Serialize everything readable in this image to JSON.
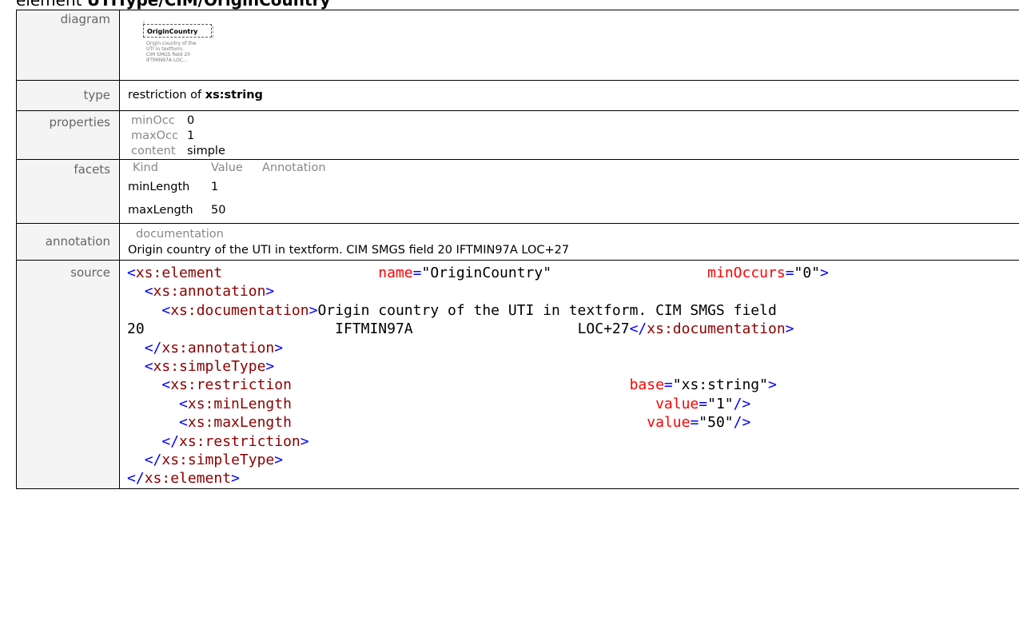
{
  "heading": {
    "kind": "element",
    "name": "UTIType/CIM/OriginCountry"
  },
  "labels": {
    "diagram": "diagram",
    "type": "type",
    "properties": "properties",
    "facets": "facets",
    "annotation": "annotation",
    "source": "source"
  },
  "diagram": {
    "element_name": "OriginCountry",
    "note_lines": [
      "Origin country of the",
      "UTI in textform.",
      "CIM SMGS field 20",
      "IFTMIN97A LOC..."
    ]
  },
  "type": {
    "prefix": "restriction of",
    "base": "xs:string"
  },
  "properties": [
    {
      "key": "minOcc",
      "value": "0"
    },
    {
      "key": "maxOcc",
      "value": "1"
    },
    {
      "key": "content",
      "value": "simple"
    }
  ],
  "facets": {
    "headers": [
      "Kind",
      "Value",
      "Annotation"
    ],
    "rows": [
      {
        "kind": "minLength",
        "value": "1",
        "annotation": ""
      },
      {
        "kind": "maxLength",
        "value": "50",
        "annotation": ""
      }
    ]
  },
  "annotation": {
    "header": "documentation",
    "text": "Origin country of the UTI in textform. CIM SMGS field 20 IFTMIN97A LOC+27"
  },
  "source": {
    "element_tag": "xs:element",
    "name_attr": "name",
    "name_val": "\"OriginCountry\"",
    "minocc_attr": "minOccurs",
    "minocc_val": "\"0\"",
    "annotation_tag": "xs:annotation",
    "documentation_tag": "xs:documentation",
    "doc_text_1": "Origin country of the UTI in textform. CIM SMGS field",
    "doc_text_2a": "20",
    "doc_text_2b": "IFTMIN97A",
    "doc_text_2c": "LOC+27",
    "simpletype_tag": "xs:simpleType",
    "restriction_tag": "xs:restriction",
    "base_attr": "base",
    "base_val": "\"xs:string\"",
    "minlength_tag": "xs:minLength",
    "maxlength_tag": "xs:maxLength",
    "value_attr": "value",
    "minlength_val": "\"1\"",
    "maxlength_val": "\"50\""
  }
}
